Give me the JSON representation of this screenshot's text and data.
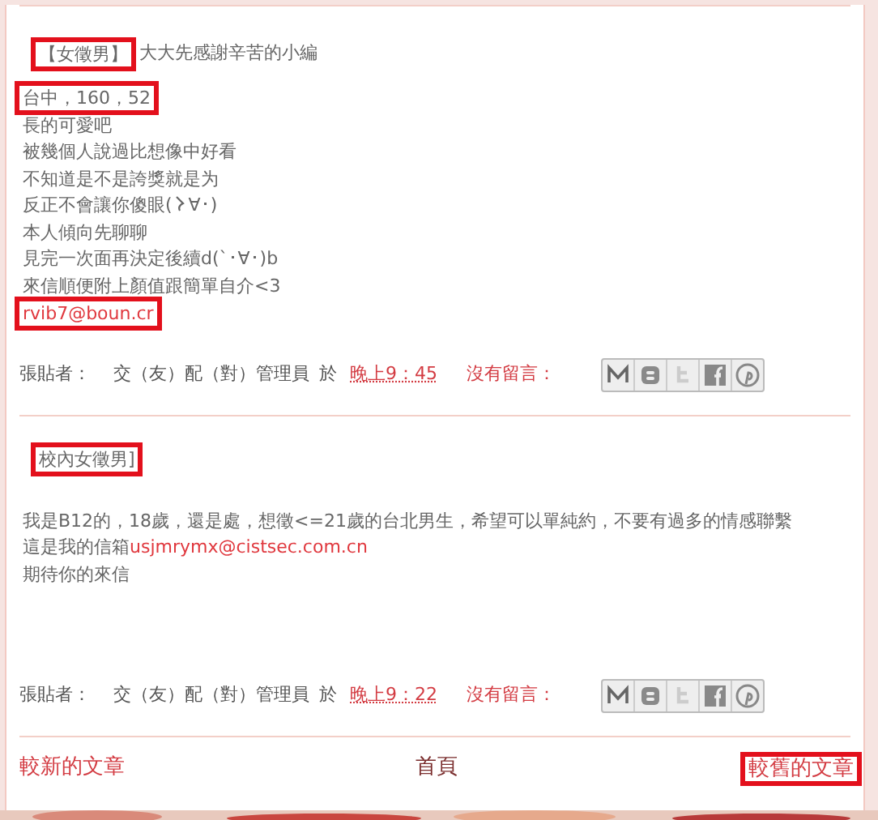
{
  "posts": [
    {
      "title": "【女徵男】",
      "title_highlighted": true,
      "title_rest": "大大先感謝辛苦的小編",
      "lines": [
        {
          "highlighted": true,
          "parts": [
            {
              "kind": "text",
              "text": "台中，160，52"
            }
          ]
        },
        {
          "highlighted": false,
          "parts": [
            {
              "kind": "text",
              "text": "長的可愛吧"
            }
          ]
        },
        {
          "highlighted": false,
          "parts": [
            {
              "kind": "text",
              "text": "被幾個人說過比想像中好看"
            }
          ]
        },
        {
          "highlighted": false,
          "parts": [
            {
              "kind": "text",
              "text": "不知道是不是誇獎就是为"
            }
          ]
        },
        {
          "highlighted": false,
          "parts": [
            {
              "kind": "text",
              "text": "反正不會讓你傻眼("
            },
            {
              "kind": "hook"
            },
            {
              "kind": "text",
              "text": "∀･)"
            }
          ]
        },
        {
          "highlighted": false,
          "parts": [
            {
              "kind": "text",
              "text": "本人傾向先聊聊"
            }
          ]
        },
        {
          "highlighted": false,
          "parts": [
            {
              "kind": "text",
              "text": "見完一次面再決定後續d(`･∀･)b"
            }
          ]
        },
        {
          "highlighted": false,
          "parts": [
            {
              "kind": "text",
              "text": "來信順便附上顏值跟簡單自介<3"
            }
          ]
        },
        {
          "highlighted": true,
          "parts": [
            {
              "kind": "email",
              "text": "rvib7@boun.cr"
            }
          ]
        }
      ],
      "author_label": "張貼者：",
      "author": "交（友）配（對）管理員",
      "at": "於",
      "time": "晚上9：45",
      "comments": "沒有留言："
    },
    {
      "title": "校內女徵男]",
      "title_highlighted": true,
      "lines": [
        {
          "highlighted": false,
          "parts": [
            {
              "kind": "text",
              "text": "我是B12的，18歲，還是處，想徵<=21歲的台北男生，希望可以單純約，不要有過多的情感聯繫"
            }
          ]
        },
        {
          "highlighted": false,
          "parts": [
            {
              "kind": "text",
              "text": "這是我的信箱"
            },
            {
              "kind": "email",
              "text": "usjmrymx@cistsec.com.cn"
            }
          ]
        },
        {
          "highlighted": false,
          "parts": [
            {
              "kind": "text",
              "text": "期待你的來信"
            }
          ]
        }
      ],
      "author_label": "張貼者：",
      "author": "交（友）配（對）管理員",
      "at": "於",
      "time": "晚上9：22",
      "comments": "沒有留言："
    }
  ],
  "pager": {
    "newer": {
      "label": "較新的文章",
      "highlighted": false
    },
    "home": {
      "label": "首頁",
      "highlighted": false
    },
    "older": {
      "label": "較舊的文章",
      "highlighted": true
    }
  }
}
